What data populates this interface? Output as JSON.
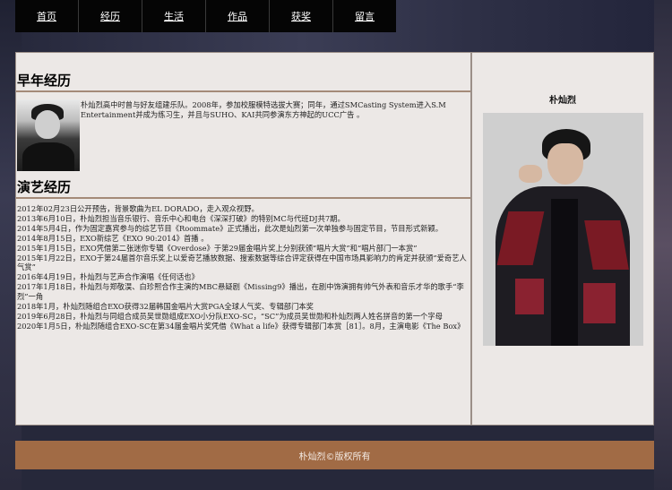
{
  "nav": {
    "items": [
      "首页",
      "经历",
      "生活",
      "作品",
      "获奖",
      "留言"
    ]
  },
  "main": {
    "early_title": "早年经历",
    "early_text": "朴灿烈高中时曾与好友组建乐队。2008年，参加校服模特选拔大赛；同年，通过SMCasting System进入S.M Entertainment并成为练习生，并且与SUHO、KAI共同参演东方神起的UCC广告 。",
    "career_title": "演艺经历",
    "career_items": [
      "2012年02月23日公开预告，背景歌曲为EL DORADO，走入观众视野。",
      "2013年6月10日，朴灿烈担当音乐银行、音乐中心和电台《深深打破》的特别MC与代班DJ共7期。",
      "2014年5月4日，作为固定嘉宾参与的综艺节目《Roommate》正式播出，此次是灿烈第一次单独参与固定节目，节目形式新颖。",
      "2014年8月15日，EXO新综艺《EXO 90:2014》首播 。",
      "2015年1月15日，EXO凭借第二张迷你专辑《Overdose》于第29届金唱片奖上分别获颁“唱片大赏”和“唱片部门一本赏”",
      "2015年1月22日，EXO于第24届首尔音乐奖上以爱奇艺播放数据、搜索数据等综合评定获得在中国市场具影响力的肯定并获颁“爱奇艺人气赏”",
      "2016年4月19日，朴灿烈与艺声合作演唱《任何话也》",
      "2017年1月18日，朴灿烈与郑敬淏、白珍熙合作主演的MBC悬疑剧《Missing9》播出，在剧中饰演拥有帅气外表和音乐才华的歌手“李烈”一角",
      "2018年1月，朴灿烈随组合EXO获得32届韩国金唱片大赏PGA全球人气奖、专辑部门本奖",
      "2019年6月28日，朴灿烈与同组合成员吴世勋组成EXO小分队EXO-SC，“SC”为成员吴世勋和朴灿烈两人姓名拼音的第一个字母",
      "2020年1月5日，朴灿烈随组合EXO-SC在第34届金唱片奖凭借《What a life》获得专辑部门本赏［81］。8月，主演电影《The Box》"
    ]
  },
  "side": {
    "name": "朴灿烈"
  },
  "footer": {
    "text": "朴灿烈©版权所有"
  },
  "colors": {
    "nav_bg": "#050505",
    "panel_bg": "#ece8e6",
    "title_rule": "#a48a78",
    "footer_bg": "#a16b45"
  }
}
